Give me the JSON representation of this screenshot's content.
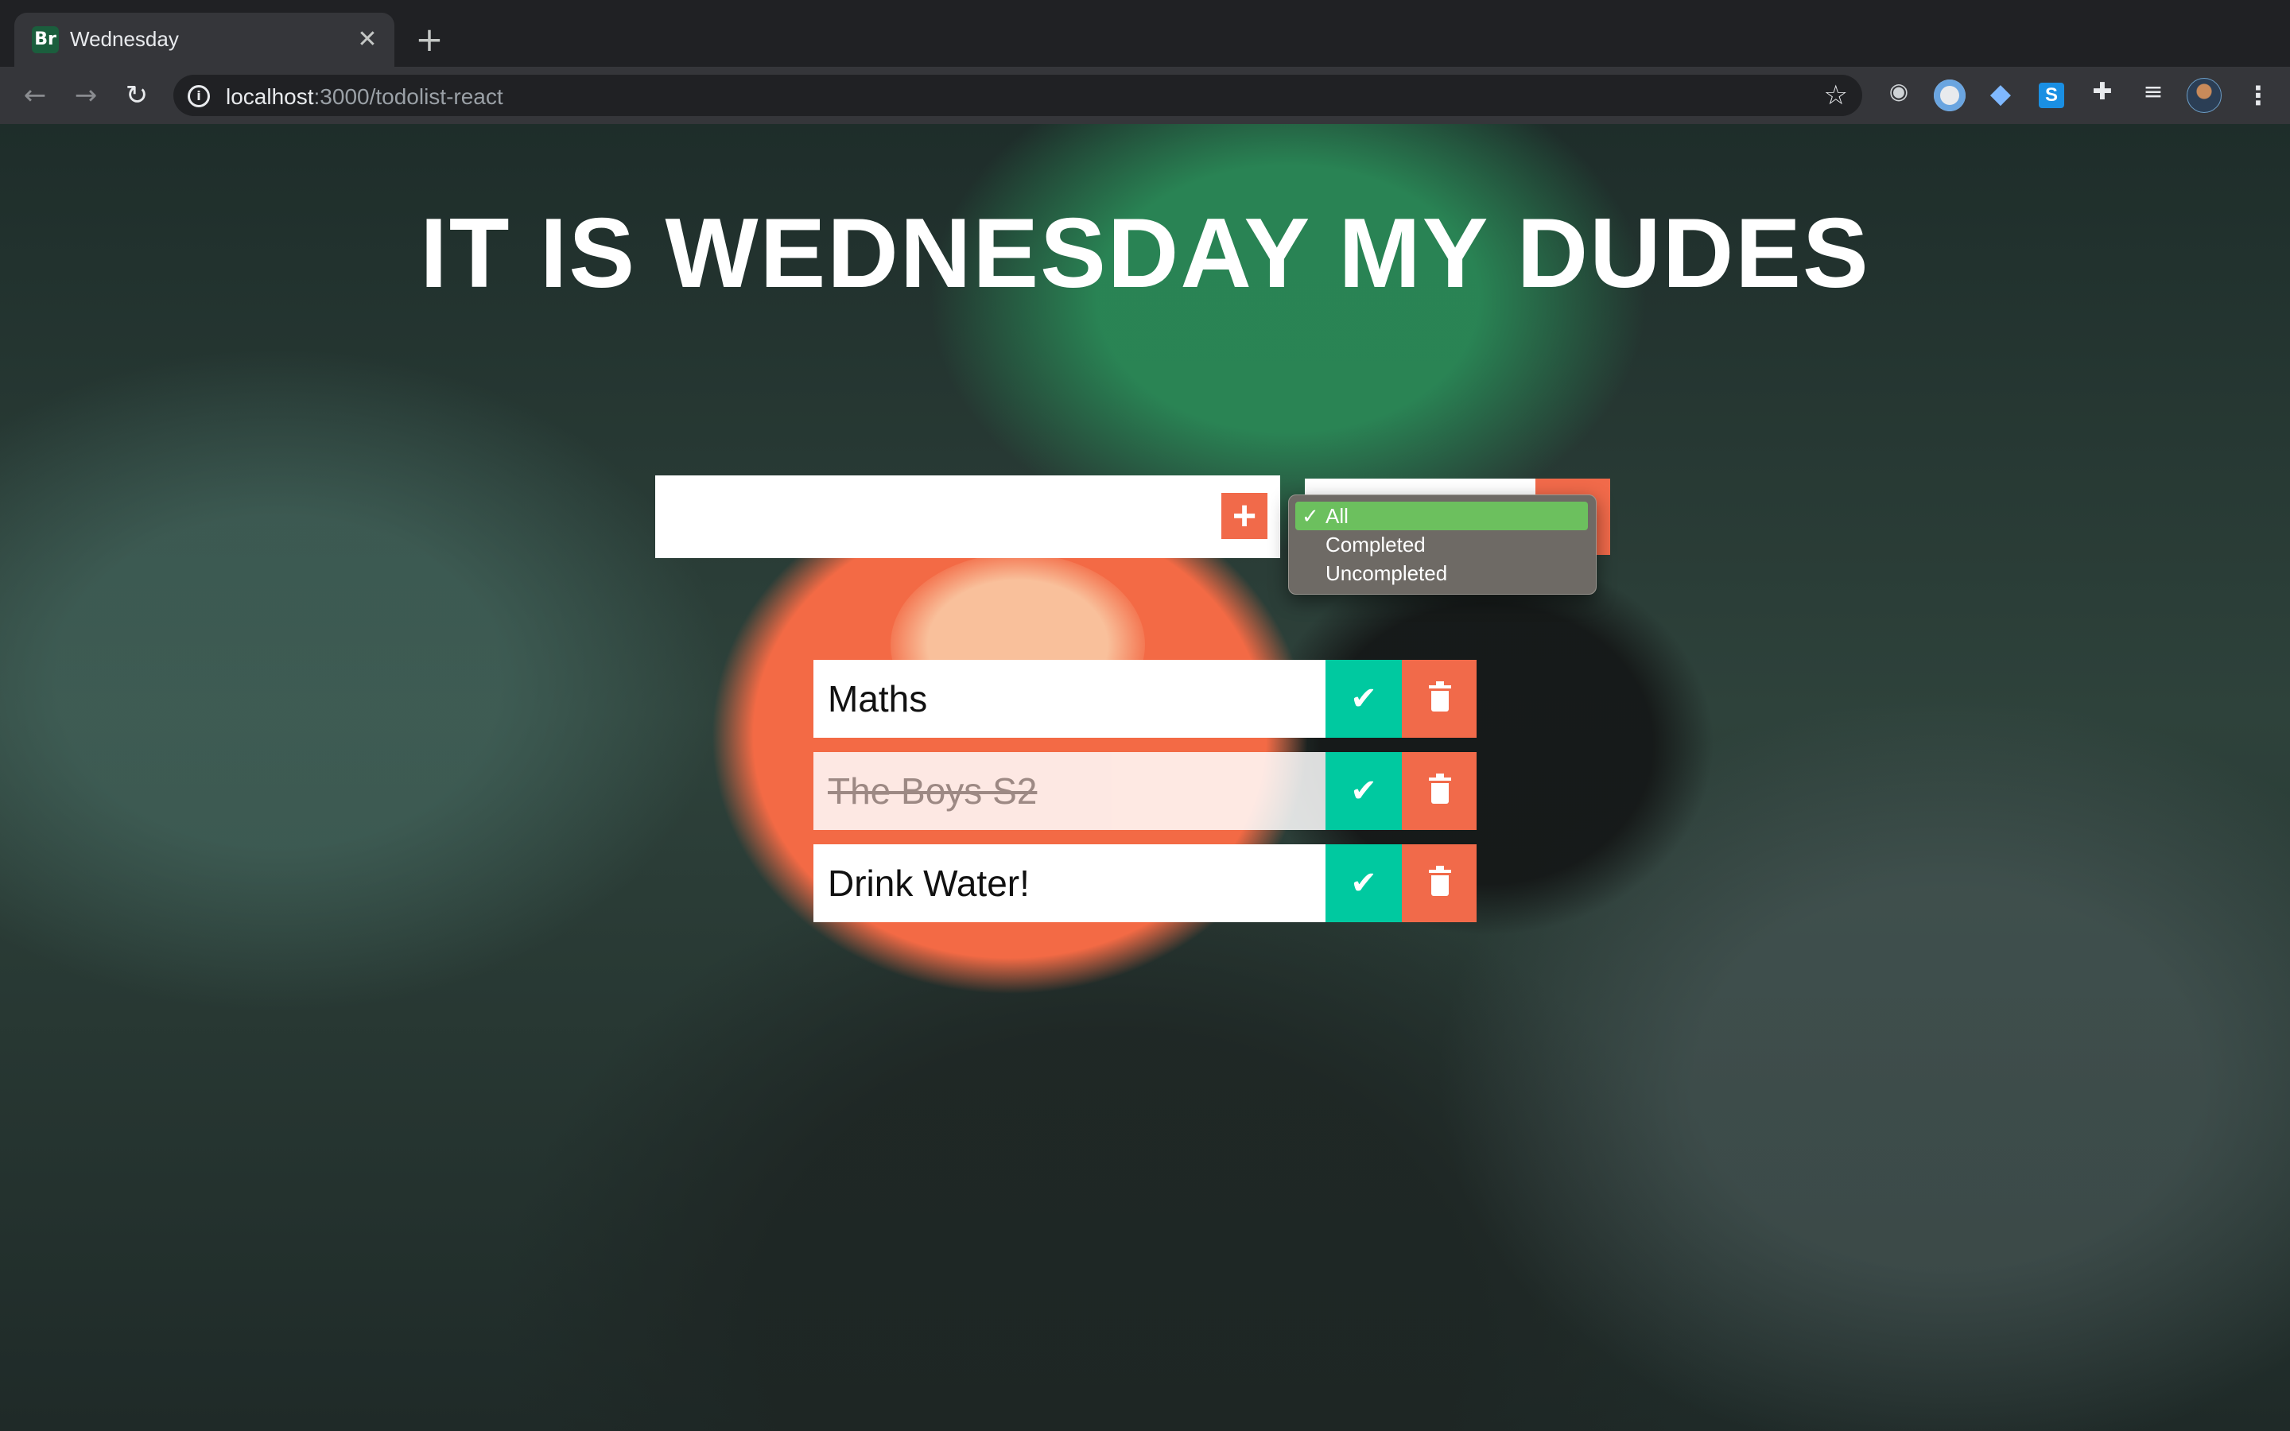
{
  "browser": {
    "tab": {
      "favicon_text": "Br",
      "title": "Wednesday",
      "close_glyph": "✕"
    },
    "new_tab_glyph": "+",
    "nav": {
      "back_glyph": "←",
      "forward_glyph": "→",
      "reload_glyph": "↻"
    },
    "address_bar": {
      "host": "localhost",
      "path": ":3000/todolist-react",
      "info_glyph": "i"
    },
    "extensions": [
      "spy-extension-icon",
      "circle-extension-icon",
      "gem-extension-icon",
      "s-extension-icon",
      "puzzle-icon",
      "reading-queue-icon"
    ],
    "extension_s_letter": "S"
  },
  "page": {
    "title": "IT IS WEDNESDAY MY DUDES",
    "input": {
      "value": "",
      "placeholder": ""
    },
    "add_glyph": "+",
    "filter": {
      "selected": "All",
      "check_glyph": "✓",
      "options": [
        {
          "label": "All",
          "selected": true
        },
        {
          "label": "Completed",
          "selected": false
        },
        {
          "label": "Uncompleted",
          "selected": false
        }
      ]
    },
    "todos": [
      {
        "text": "Maths",
        "completed": false
      },
      {
        "text": "The Boys S2",
        "completed": true
      },
      {
        "text": "Drink Water!",
        "completed": false
      }
    ],
    "check_glyph": "✔"
  },
  "colors": {
    "accent": "#f16a4a",
    "complete": "#00c9a0",
    "dropdown_selected": "#6cc05e"
  }
}
